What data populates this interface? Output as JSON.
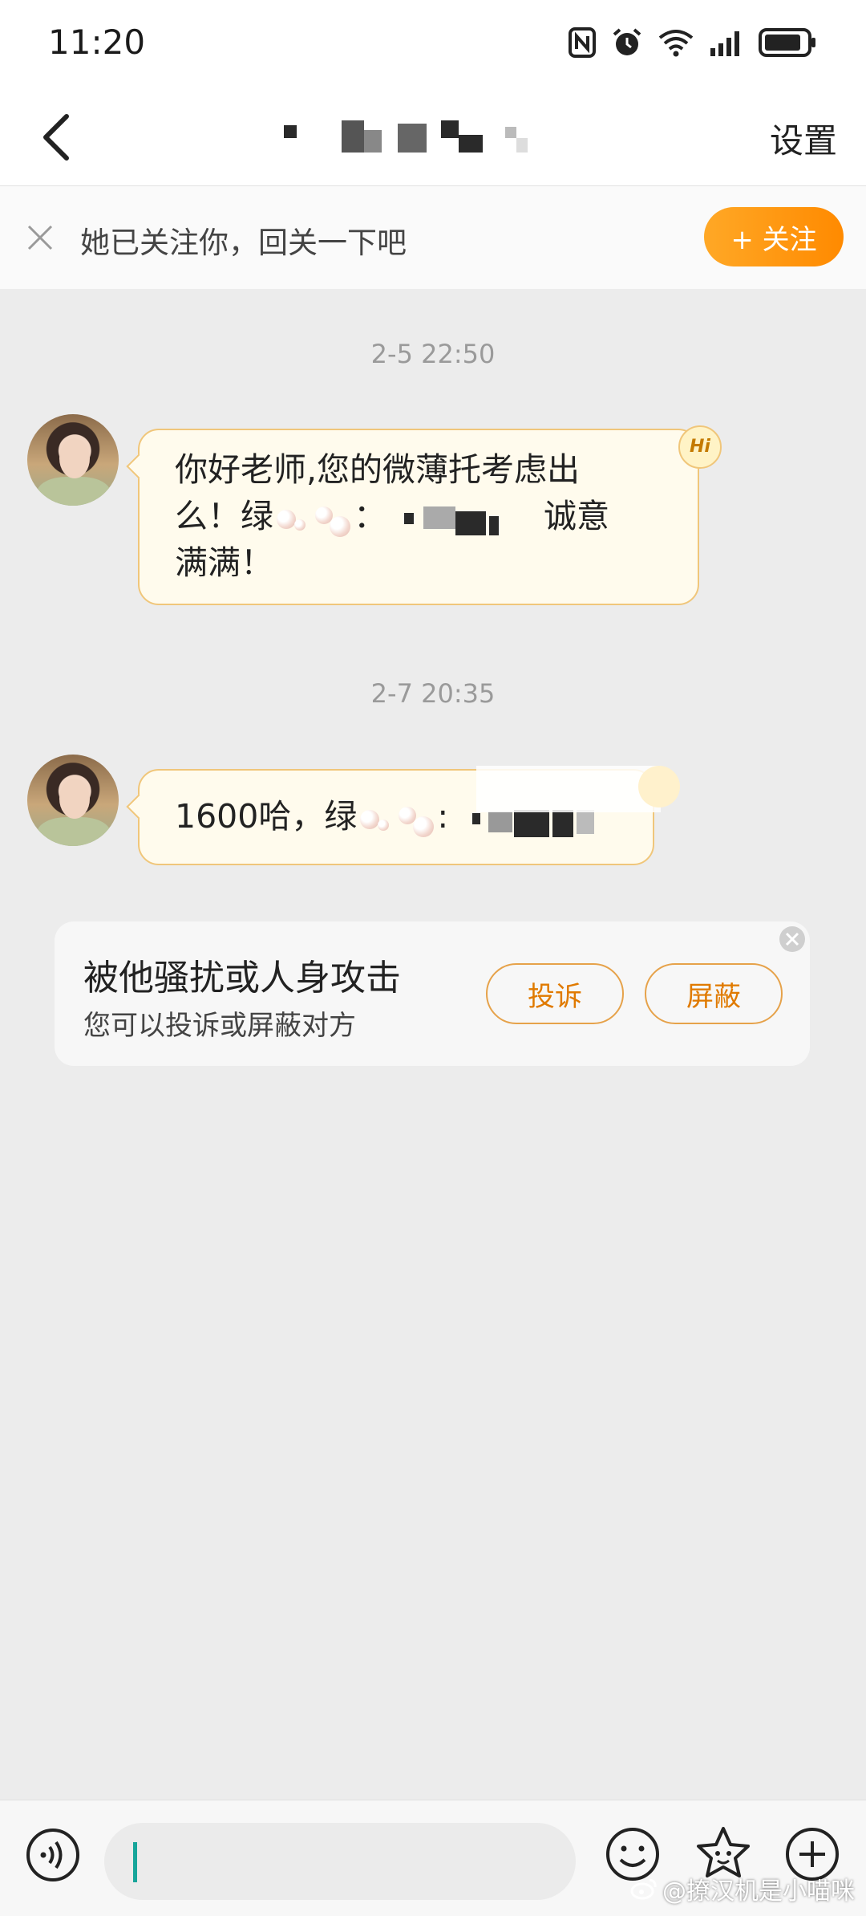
{
  "status_bar": {
    "time": "11:20",
    "icons": [
      "nfc-icon",
      "alarm-icon",
      "wifi-icon",
      "signal-icon",
      "battery-icon"
    ]
  },
  "header": {
    "title_pixelated": true,
    "settings_label": "设置"
  },
  "follow_banner": {
    "text": "她已关注你，回关一下吧",
    "button_label": "+ 关注"
  },
  "messages": [
    {
      "timestamp": "2-5 22:50",
      "line1": "你好老师,您的微薄托考虑出",
      "line2_a": "么！绿",
      "line2_b": "：",
      "line2_c": "诚意",
      "line3": "满满！",
      "badge": "Hi"
    },
    {
      "timestamp": "2-7 20:35",
      "text_a": "1600哈，绿",
      "text_b": ":"
    }
  ],
  "safety_card": {
    "title": "被他骚扰或人身攻击",
    "subtitle": "您可以投诉或屏蔽对方",
    "report_label": "投诉",
    "block_label": "屏蔽"
  },
  "input_bar": {
    "value": ""
  },
  "watermark": "@撩汉机是小喵咪",
  "colors": {
    "accent": "#ff8a00",
    "bubble_bg": "#fffbed",
    "bubble_border": "#f0c67a",
    "background": "#ececec"
  }
}
